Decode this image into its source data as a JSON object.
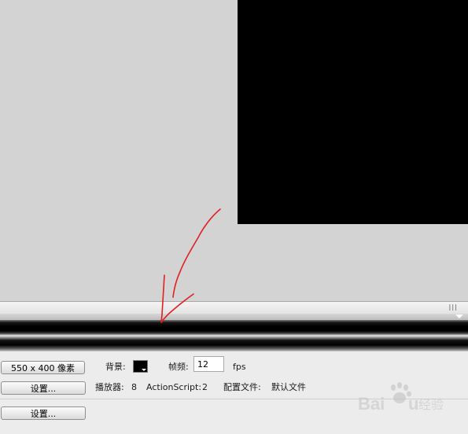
{
  "document": {
    "size_button": "550 x 400 像素",
    "background_label": "背景:",
    "background_color": "#000000",
    "framerate_label": "帧频:",
    "framerate_value": "12",
    "fps_unit": "fps"
  },
  "publish": {
    "settings_button": "设置...",
    "player_label": "播放器:",
    "player_value": "8",
    "actionscript_label": "ActionScript:",
    "actionscript_value": "2",
    "profile_label": "配置文件:",
    "profile_value": "默认文件"
  },
  "extra": {
    "settings_button": "设置..."
  },
  "colors": {
    "stage": "#000000",
    "pasteboard": "#d3d3d3",
    "annotation": "#e02020"
  },
  "icons": {
    "scroll_grip": "vertical-grip-icon",
    "panel_menu": "panel-menu-arrow-icon",
    "color_dropdown": "dropdown-triangle-icon"
  },
  "watermark": {
    "text": "Baidu 经验"
  }
}
